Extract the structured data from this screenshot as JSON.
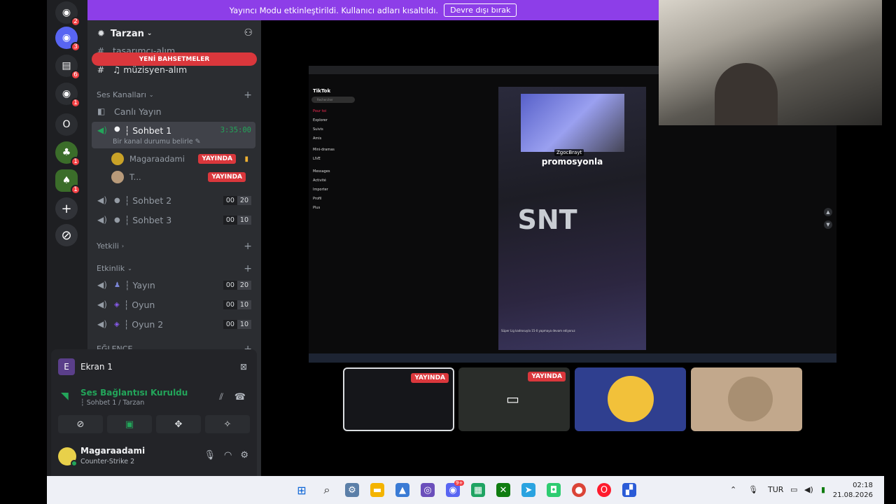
{
  "banner": {
    "text": "Yayıncı Modu etkinleştirildi. Kullanıcı adları kısaltıldı.",
    "button": "Devre dışı bırak"
  },
  "rail": {
    "badges": [
      "2",
      "3",
      "6",
      "1",
      "1",
      "1"
    ],
    "letter_server": "O"
  },
  "server": {
    "name": "Tarzan"
  },
  "channels": {
    "text_top": "tasarımcı-alım",
    "text_second": "müzisyen-alım",
    "mention_pill": "YENİ BAHSETMELER",
    "voice_category": "Ses Kanalları",
    "live_channel": "Canlı Yayın",
    "active": {
      "name": "┆ Sohbet 1",
      "time": "3:35:00",
      "status": "Bir kanal durumu belirle"
    },
    "members": [
      {
        "name": "Magaraadami",
        "badge": "YAYINDA"
      },
      {
        "name": "T...",
        "badge": "YAYINDA"
      }
    ],
    "voice_rooms": [
      {
        "name": "┆ Sohbet 2",
        "count": "00",
        "limit": "20"
      },
      {
        "name": "┆ Sohbet 3",
        "count": "00",
        "limit": "10"
      }
    ],
    "cat_yetkili": "Yetkili",
    "cat_etkinlik": "Etkinlik",
    "event_rooms": [
      {
        "name": "┆ Yayın",
        "count": "00",
        "limit": "20"
      },
      {
        "name": "┆ Oyun",
        "count": "00",
        "limit": "10"
      },
      {
        "name": "┆ Oyun 2",
        "count": "00",
        "limit": "10"
      }
    ],
    "cat_eglence": "EĞLENCE"
  },
  "voice_panel": {
    "screen_label": "Ekran 1",
    "screen_initial": "E",
    "status": "Ses Bağlantısı Kuruldu",
    "location": "┆ Sohbet 1 / Tarzan",
    "user": "Magaraadami",
    "activity": "Counter-Strike 2"
  },
  "stream": {
    "tiktok_logo": "TikTok",
    "search": "Rechercher",
    "menu": [
      "Pour toi",
      "Explorer",
      "Suivis",
      "Amis",
      "Mini-dramas",
      "LIVE",
      "Messages",
      "Activité",
      "Importer",
      "Profil",
      "Plus"
    ],
    "streamer_tag": "ZgocBrayt",
    "caption": "promosyonla",
    "big_text": "SNT",
    "video_footer": "Süper Lig kadrosuyla 15-0 yapmaya devam ediyoruz"
  },
  "tiles": [
    {
      "badge": "YAYINDA"
    },
    {
      "badge": "YAYINDA"
    },
    {},
    {}
  ],
  "taskbar": {
    "lang": "TUR",
    "time": "02:18",
    "date": "21.08.2026",
    "notif": "9+"
  }
}
